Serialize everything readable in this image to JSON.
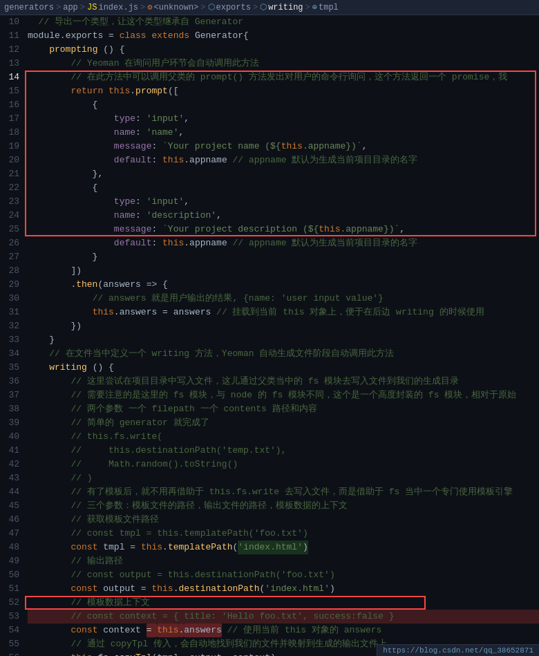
{
  "breadcrumb": {
    "items": [
      {
        "label": "generators",
        "icon": "folder"
      },
      {
        "label": "app",
        "icon": "folder"
      },
      {
        "label": "index.js",
        "icon": "js-file"
      },
      {
        "label": "<unknown>",
        "icon": "unknown"
      },
      {
        "label": "exports",
        "icon": "exports"
      },
      {
        "label": "writing",
        "icon": "writing"
      },
      {
        "label": "tmpl",
        "icon": "ref"
      }
    ],
    "separators": [
      ">",
      ">",
      ">",
      ">",
      ">",
      ">"
    ]
  },
  "url_bar": "https://blog.csdn.net/qq_38652871",
  "lines": [
    {
      "num": 10,
      "content": "module.exports = class extends Generator{"
    },
    {
      "num": 11,
      "content": "    prompting () {"
    },
    {
      "num": 12,
      "content": "        // Yeoman 在询问用户环节会自动调用此方法"
    },
    {
      "num": 13,
      "content": "        // 在此方法中可以调用父类的 prompt() 方法发出对用户的命令行询问，这个方法返回一个 promise，我"
    },
    {
      "num": 14,
      "content": "        return this.prompt(["
    },
    {
      "num": 15,
      "content": "            {"
    },
    {
      "num": 16,
      "content": "                type: 'input',"
    },
    {
      "num": 17,
      "content": "                name: 'name',"
    },
    {
      "num": 18,
      "content": "                message: `Your project name (${this.appname})`,"
    },
    {
      "num": 19,
      "content": "                default: this.appname // appname 默认为生成当前项目目录的名字"
    },
    {
      "num": 20,
      "content": "            },"
    },
    {
      "num": 21,
      "content": "            {"
    },
    {
      "num": 22,
      "content": "                type: 'input',"
    },
    {
      "num": 23,
      "content": "                name: 'description',"
    },
    {
      "num": 24,
      "content": "                message: `Your project description (${this.appname})`,"
    },
    {
      "num": 25,
      "content": "                default: this.appname // appname 默认为生成当前项目目录的名字"
    },
    {
      "num": 26,
      "content": "            }"
    },
    {
      "num": 27,
      "content": "        ])"
    },
    {
      "num": 28,
      "content": "        .then(answers => {"
    },
    {
      "num": 29,
      "content": "            // answers 就是用户输出的结果, {name: 'user input value'}"
    },
    {
      "num": 30,
      "content": "            this.answers = answers // 挂载到当前 this 对象上，便于在后边 writing 的时候使用"
    },
    {
      "num": 31,
      "content": "        })"
    },
    {
      "num": 32,
      "content": "    }"
    },
    {
      "num": 33,
      "content": "    // 在文件当中定义一个 writing 方法，Yeoman 自动生成文件阶段自动调用此方法"
    },
    {
      "num": 34,
      "content": "    writing () {"
    },
    {
      "num": 35,
      "content": "        // 这里尝试在项目目录中写入文件，这儿通过父类当中的 fs 模块去写入文件到我们的生成目录"
    },
    {
      "num": 36,
      "content": "        // 需要注意的是这里的 fs 模块，与 node 的 fs 模块不同，这个是一个高度封装的 fs 模块，相对于原始"
    },
    {
      "num": 37,
      "content": "        // 两个参数 一个 filepath 一个 contents 路径和内容"
    },
    {
      "num": 38,
      "content": "        // 简单的 generator 就完成了"
    },
    {
      "num": 39,
      "content": "        // this.fs.write("
    },
    {
      "num": 40,
      "content": "        //     this.destinationPath('temp.txt'),"
    },
    {
      "num": 41,
      "content": "        //     Math.random().toString()"
    },
    {
      "num": 42,
      "content": "        // )"
    },
    {
      "num": 43,
      "content": "        // 有了模板后，就不用再借助于 this.fs.write 去写入文件，而是借助于 fs 当中一个专门使用模板引擎"
    },
    {
      "num": 44,
      "content": "        // 三个参数：模板文件的路径，输出文件的路径，模板数据的上下文"
    },
    {
      "num": 45,
      "content": "        // 获取模板文件路径"
    },
    {
      "num": 46,
      "content": "        // const tmpl = this.templatePath('foo.txt')"
    },
    {
      "num": 47,
      "content": "        const tmpl = this.templatePath('index.html')"
    },
    {
      "num": 48,
      "content": "        // 输出路径"
    },
    {
      "num": 49,
      "content": "        // const output = this.destinationPath('foo.txt')"
    },
    {
      "num": 50,
      "content": "        const output = this.destinationPath('index.html')"
    },
    {
      "num": 51,
      "content": "        // 模板数据上下文"
    },
    {
      "num": 52,
      "content": "        // const context = { title: 'Hello foo.txt', success:false }"
    },
    {
      "num": 53,
      "content": "        const context = this.answers // 使用当前 this 对象的 answers"
    },
    {
      "num": 54,
      "content": "        // 通过 copyTpl 传入，会自动地找到我们的文件并映射到生成的输出文件上"
    },
    {
      "num": 55,
      "content": "        this.fs.copyTpl(tmpl, output, context)"
    },
    {
      "num": 56,
      "content": "    }"
    }
  ]
}
